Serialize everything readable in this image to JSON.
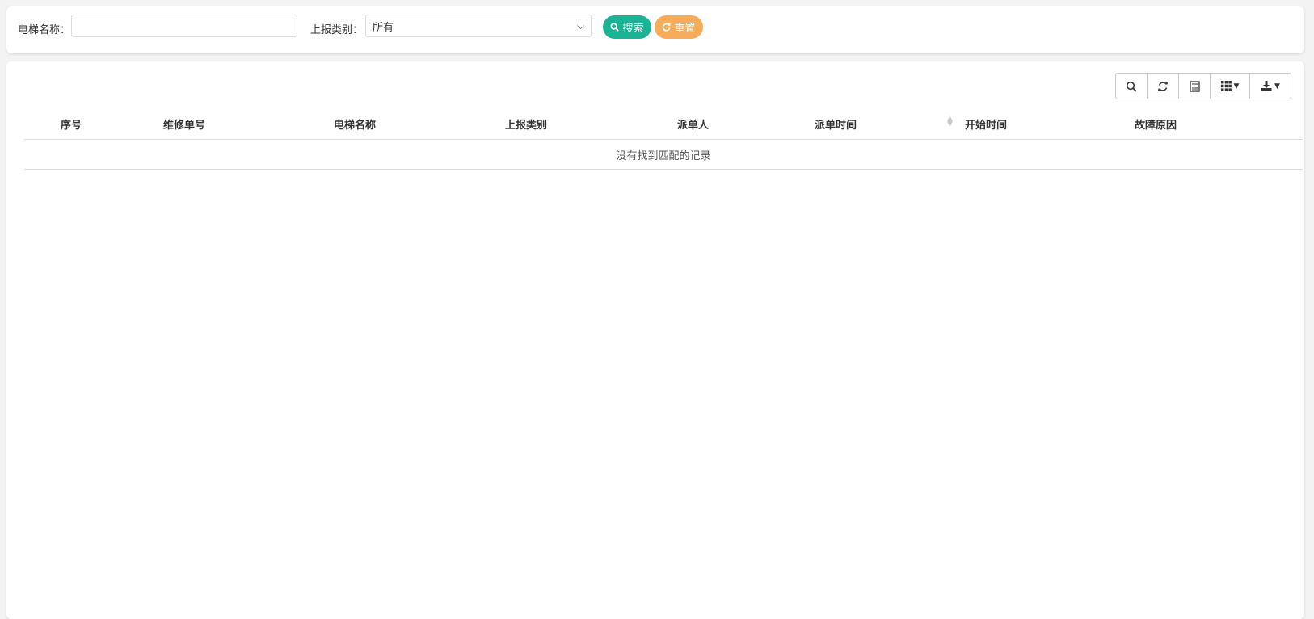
{
  "search": {
    "elevator_name_label": "电梯名称：",
    "elevator_name_value": "",
    "report_type_label": "上报类别：",
    "report_type_selected": "所有",
    "search_button": "搜索",
    "reset_button": "重置"
  },
  "colors": {
    "search_button": "#1ab394",
    "reset_button": "#f8ac59"
  },
  "toolbar": {
    "icons": [
      "search-icon",
      "refresh-icon",
      "list-icon",
      "columns-icon",
      "export-icon"
    ]
  },
  "table": {
    "columns": [
      "序号",
      "维修单号",
      "电梯名称",
      "上报类别",
      "派单人",
      "派单时间",
      "开始时间",
      "故障原因"
    ],
    "empty_text": "没有找到匹配的记录"
  }
}
